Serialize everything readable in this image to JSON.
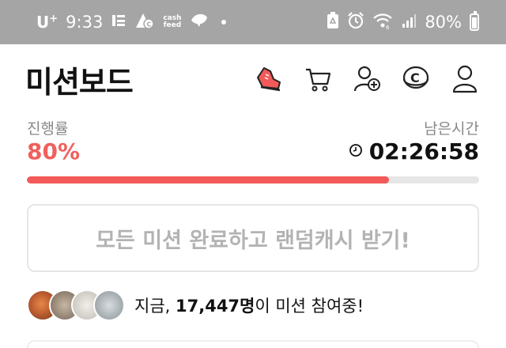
{
  "status_bar": {
    "carrier": "U",
    "carrier_sup": "+",
    "time": "9:33",
    "cashfeed_line1": "cash",
    "cashfeed_line2": "feed",
    "battery": "80%"
  },
  "header": {
    "title": "미션보드",
    "icons": [
      "shoe-icon",
      "cart-icon",
      "add-friend-icon",
      "coin-icon",
      "profile-icon"
    ]
  },
  "progress": {
    "label": "진행률",
    "value_text": "80%",
    "fraction": 0.8,
    "remaining_label": "남은시간",
    "remaining_time": "02:26:58"
  },
  "random_button": {
    "label": "모든 미션 완료하고 랜덤캐시 받기!"
  },
  "participants": {
    "prefix": "지금, ",
    "count": "17,447명",
    "suffix": "이 미션 참여중!"
  },
  "colors": {
    "accent": "#f25a5a",
    "status_bar": "#a5a5a5",
    "button_text": "#b3b3b3"
  }
}
